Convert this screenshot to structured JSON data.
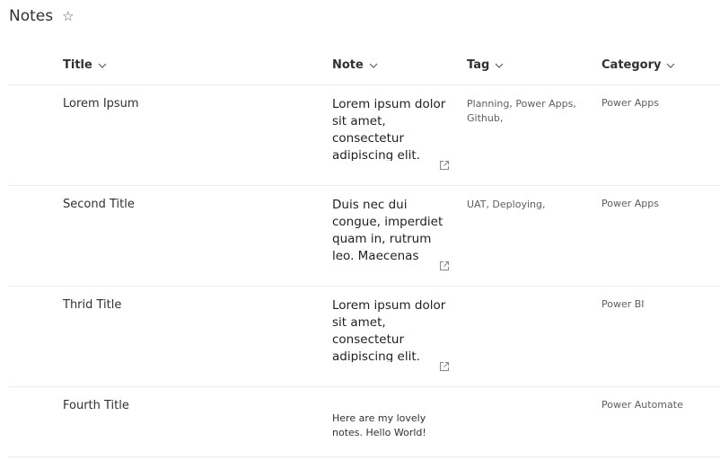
{
  "page": {
    "title": "Notes"
  },
  "columns": {
    "title": "Title",
    "note": "Note",
    "tag": "Tag",
    "category": "Category"
  },
  "rows": [
    {
      "title": "Lorem Ipsum",
      "note": "Lorem ipsum dolor sit amet, consectetur adipiscing elit. Quisque nec nibh in libero",
      "tag": "Planning, Power Apps, Github,",
      "category": "Power Apps"
    },
    {
      "title": "Second Title",
      "note": "Duis nec dui congue, imperdiet quam in, rutrum leo. Maecenas convallis nulla",
      "tag": "UAT, Deploying,",
      "category": "Power Apps"
    },
    {
      "title": "Thrid Title",
      "note": "Lorem ipsum dolor sit amet, consectetur adipiscing elit. Quisque nec nibh in libero",
      "tag": "",
      "category": "Power BI"
    },
    {
      "title": "Fourth Title",
      "note": "Here are my lovely notes. Hello World!",
      "tag": "",
      "category": "Power Automate"
    }
  ]
}
